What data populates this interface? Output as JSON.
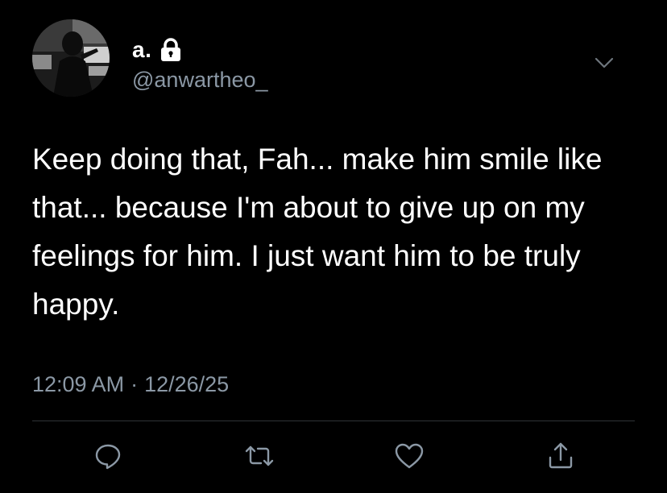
{
  "user": {
    "display_name": "a.",
    "handle": "@anwartheo_",
    "protected": true,
    "avatar_icon": "profile-photo"
  },
  "tweet": {
    "text": "Keep doing that, Fah... make him smile like that... because I'm about to give up on my feelings for him. I just want him to be truly happy.",
    "time": "12:09 AM",
    "separator": "·",
    "date": "12/26/25"
  },
  "actions": [
    {
      "icon": "reply-icon"
    },
    {
      "icon": "retweet-icon"
    },
    {
      "icon": "like-icon"
    },
    {
      "icon": "share-icon"
    }
  ],
  "colors": {
    "background": "#000000",
    "text": "#ffffff",
    "secondary_text": "#8b98a5",
    "divider": "#2f3336"
  }
}
